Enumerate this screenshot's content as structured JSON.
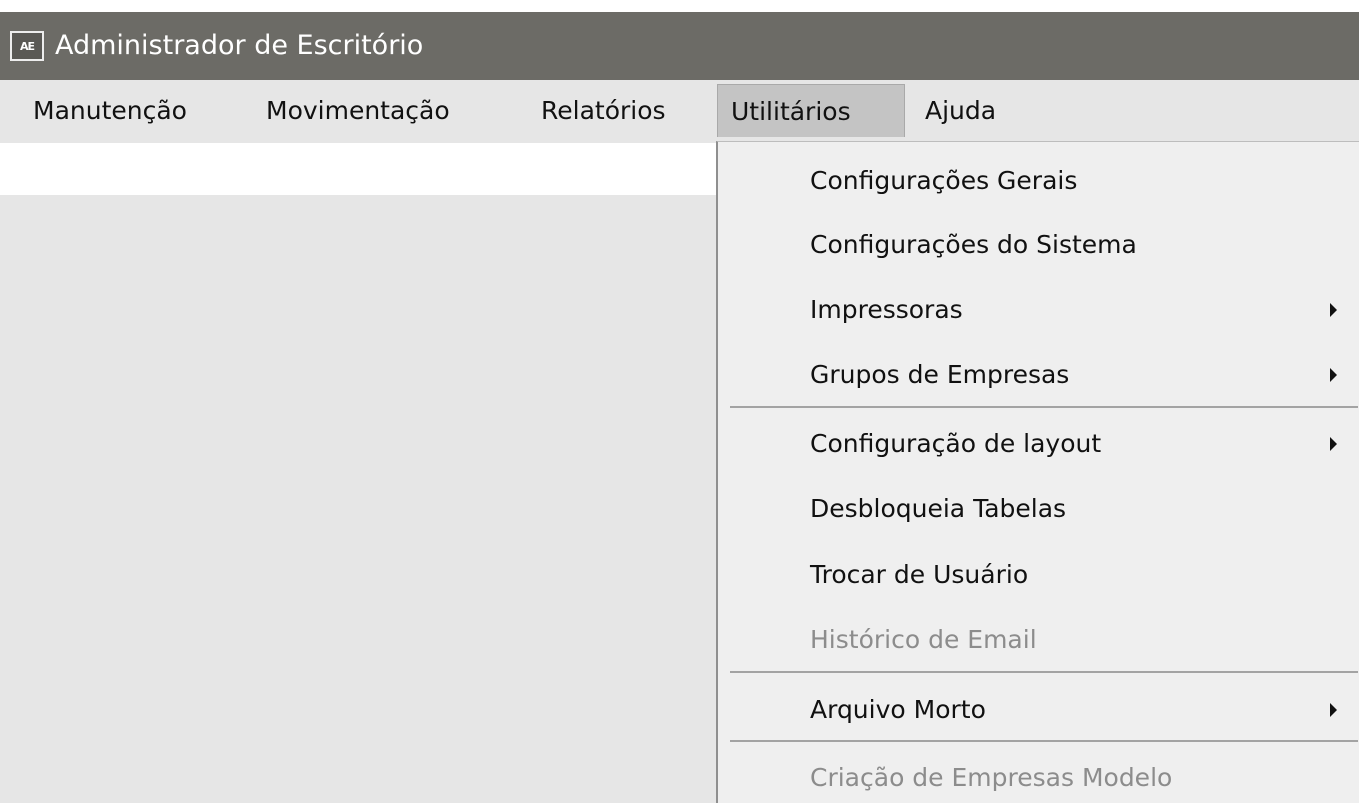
{
  "window": {
    "icon_text": "AE",
    "title": "Administrador de Escritório"
  },
  "menubar": {
    "items": [
      {
        "label": "Manutenção"
      },
      {
        "label": "Movimentação"
      },
      {
        "label": "Relatórios"
      },
      {
        "label": "Utilitários",
        "active": true
      },
      {
        "label": "Ajuda"
      }
    ]
  },
  "dropdown": {
    "items": [
      {
        "label": "Configurações Gerais",
        "enabled": true,
        "submenu": false
      },
      {
        "label": "Configurações do Sistema",
        "enabled": true,
        "submenu": false
      },
      {
        "label": "Impressoras",
        "enabled": true,
        "submenu": true
      },
      {
        "label": "Grupos de Empresas",
        "enabled": true,
        "submenu": true
      },
      {
        "label": "Configuração de layout",
        "enabled": true,
        "submenu": true
      },
      {
        "label": "Desbloqueia Tabelas",
        "enabled": true,
        "submenu": false
      },
      {
        "label": "Trocar de Usuário",
        "enabled": true,
        "submenu": false
      },
      {
        "label": "Histórico de Email",
        "enabled": false,
        "submenu": false
      },
      {
        "label": "Arquivo Morto",
        "enabled": true,
        "submenu": true
      },
      {
        "label": "Criação de Empresas Modelo",
        "enabled": false,
        "submenu": false
      }
    ]
  },
  "colors": {
    "titlebar": "#6c6b66",
    "menubar": "#e6e6e6",
    "menu_active": "#c4c4c4",
    "dropdown": "#efefef",
    "disabled_text": "#8c8c8c"
  }
}
